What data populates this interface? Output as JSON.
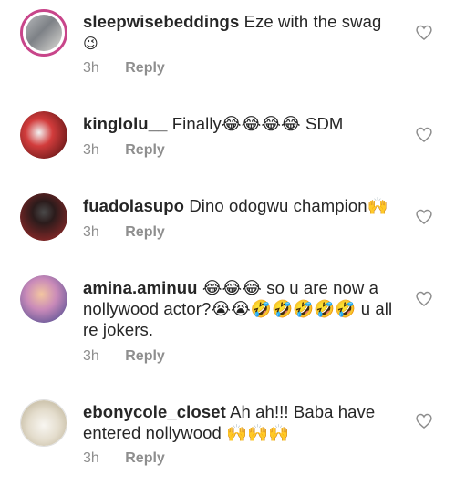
{
  "comments": [
    {
      "username": "sleepwisebeddings",
      "text": "Eze with the swag",
      "emoji": "😉",
      "time": "3h",
      "reply": "Reply",
      "avatar_color": "#8a8f95",
      "has_story": true
    },
    {
      "username": "kinglolu__",
      "text": "Finally😂😂😂😂 SDM",
      "emoji": "",
      "time": "3h",
      "reply": "Reply",
      "avatar_color": "#b03a3a",
      "has_story": false
    },
    {
      "username": "fuadolasupo",
      "text": "Dino odogwu champion🙌",
      "emoji": "",
      "time": "3h",
      "reply": "Reply",
      "avatar_color": "#5a1f1f",
      "has_story": false
    },
    {
      "username": "amina.aminuu",
      "text": "😂😂😂 so u are now a nollywood actor?😭😭🤣🤣🤣🤣🤣 u all re jokers.",
      "emoji": "",
      "time": "3h",
      "reply": "Reply",
      "avatar_color": "#c79ac0",
      "has_story": false
    },
    {
      "username": "ebonycole_closet",
      "text": "Ah ah!!! Baba have entered nollywood 🙌🙌🙌",
      "emoji": "",
      "time": "3h",
      "reply": "Reply",
      "avatar_color": "#e6e1d6",
      "has_story": false
    }
  ],
  "icons": {
    "like": "heart-outline-icon"
  }
}
